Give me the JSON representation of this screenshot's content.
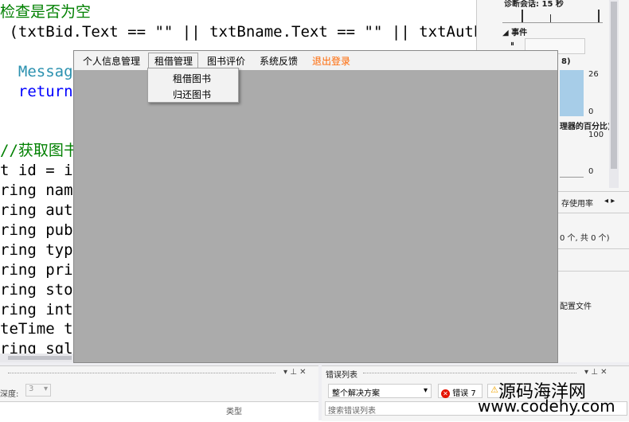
{
  "editor": {
    "lines": [
      {
        "text": "检查是否为空",
        "cls": "cmt"
      },
      {
        "text": " (txtBid.Text == \"\" || txtBname.Text == \"\" || txtAuthor.Te",
        "cls": ""
      },
      {
        "text": "",
        "cls": ""
      },
      {
        "text": "  Message",
        "cls": "typ"
      },
      {
        "text": "  return;",
        "cls": "kw"
      },
      {
        "text": "",
        "cls": ""
      },
      {
        "text": "",
        "cls": ""
      },
      {
        "text": "//获取图书",
        "cls": "cmt"
      },
      {
        "text": "t id = in",
        "cls": ""
      },
      {
        "text": "ring name",
        "cls": ""
      },
      {
        "text": "ring auth",
        "cls": ""
      },
      {
        "text": "ring pub",
        "cls": ""
      },
      {
        "text": "ring type",
        "cls": ""
      },
      {
        "text": "ring pric",
        "cls": ""
      },
      {
        "text": "ring stor",
        "cls": ""
      },
      {
        "text": "ring intr",
        "cls": ""
      },
      {
        "text": "teTime ti",
        "cls": ""
      },
      {
        "text": "ring sql",
        "cls": ""
      }
    ]
  },
  "diag": {
    "session": "诊断会话: 15 秒",
    "events": "◢ 事件",
    "pause": "⏸",
    "v26": "26",
    "v0a": "0",
    "cpu": "理器的百分比)",
    "v100": "100",
    "v0b": "0",
    "mem_tab": "存使用率",
    "count": "0 个, 共 0 个)",
    "profile": "配置文件",
    "graph_label": "8)"
  },
  "bottom": {
    "left_title": "",
    "depth_label": "深度:",
    "depth_value": "3",
    "type_header": "类型",
    "error_list_title": "错误列表",
    "scope": "整个解决方案",
    "errors_btn": "错误 7",
    "search_placeholder": "搜索错误列表"
  },
  "app": {
    "menu": [
      "个人信息管理",
      "租借管理",
      "图书评价",
      "系统反馈",
      "退出登录"
    ],
    "logout_color": "#ff6600",
    "dropdown": [
      "租借图书",
      "归还图书"
    ]
  },
  "watermark": {
    "line1": "源码海洋网",
    "line2": "www.codehy.com"
  }
}
